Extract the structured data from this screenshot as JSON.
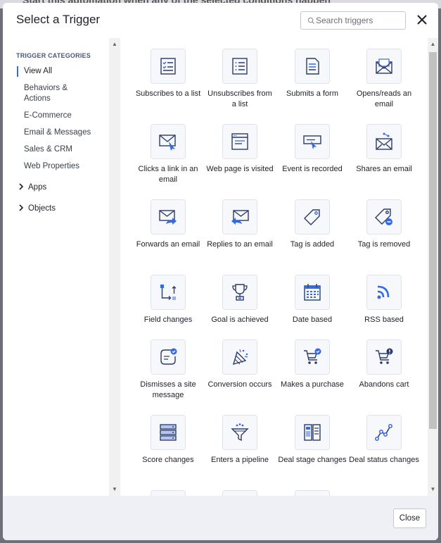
{
  "background_text": "Start this automation when any of the selected conditions happen",
  "header": {
    "title": "Select a Trigger",
    "search_placeholder": "Search triggers",
    "close_icon": "close-icon"
  },
  "sidebar": {
    "heading": "TRIGGER CATEGORIES",
    "items": [
      {
        "label": "View All",
        "active": true
      },
      {
        "label": "Behaviors & Actions"
      },
      {
        "label": "E-Commerce"
      },
      {
        "label": "Email & Messages"
      },
      {
        "label": "Sales & CRM"
      },
      {
        "label": "Web Properties"
      }
    ],
    "expandables": [
      {
        "label": "Apps",
        "icon": "chevron-right-icon"
      },
      {
        "label": "Objects",
        "icon": "chevron-right-icon"
      }
    ]
  },
  "triggers": [
    {
      "label": "Subscribes to a list",
      "icon": "list-check-icon"
    },
    {
      "label": "Unsubscribes from a list",
      "icon": "list-icon"
    },
    {
      "label": "Submits a form",
      "icon": "form-icon"
    },
    {
      "label": "Opens/reads an email",
      "icon": "open-envelope-icon"
    },
    {
      "label": "Clicks a link in an email",
      "icon": "envelope-cursor-icon"
    },
    {
      "label": "Web page is visited",
      "icon": "browser-page-icon"
    },
    {
      "label": "Event is recorded",
      "icon": "event-cursor-icon"
    },
    {
      "label": "Shares an email",
      "icon": "share-envelope-icon"
    },
    {
      "label": "Forwards an email",
      "icon": "forward-envelope-icon"
    },
    {
      "label": "Replies to an email",
      "icon": "reply-envelope-icon"
    },
    {
      "label": "Tag is added",
      "icon": "tag-icon"
    },
    {
      "label": "Tag is removed",
      "icon": "tag-remove-icon"
    },
    {
      "label": "Field changes",
      "icon": "field-change-icon"
    },
    {
      "label": "Goal is achieved",
      "icon": "trophy-icon"
    },
    {
      "label": "Date based",
      "icon": "calendar-icon"
    },
    {
      "label": "RSS based",
      "icon": "rss-icon"
    },
    {
      "label": "Dismisses a site message",
      "icon": "site-message-icon"
    },
    {
      "label": "Conversion occurs",
      "icon": "conversion-icon"
    },
    {
      "label": "Makes a purchase",
      "icon": "cart-check-icon"
    },
    {
      "label": "Abandons cart",
      "icon": "cart-alert-icon"
    },
    {
      "label": "Score changes",
      "icon": "score-icon"
    },
    {
      "label": "Enters a pipeline",
      "icon": "funnel-icon"
    },
    {
      "label": "Deal stage changes",
      "icon": "deal-stage-icon"
    },
    {
      "label": "Deal status changes",
      "icon": "deal-status-icon"
    }
  ],
  "footer": {
    "close_label": "Close"
  },
  "colors": {
    "accent": "#356ae6",
    "icon_bg": "#f7f8fb",
    "footer_bg": "#eef0f6"
  }
}
